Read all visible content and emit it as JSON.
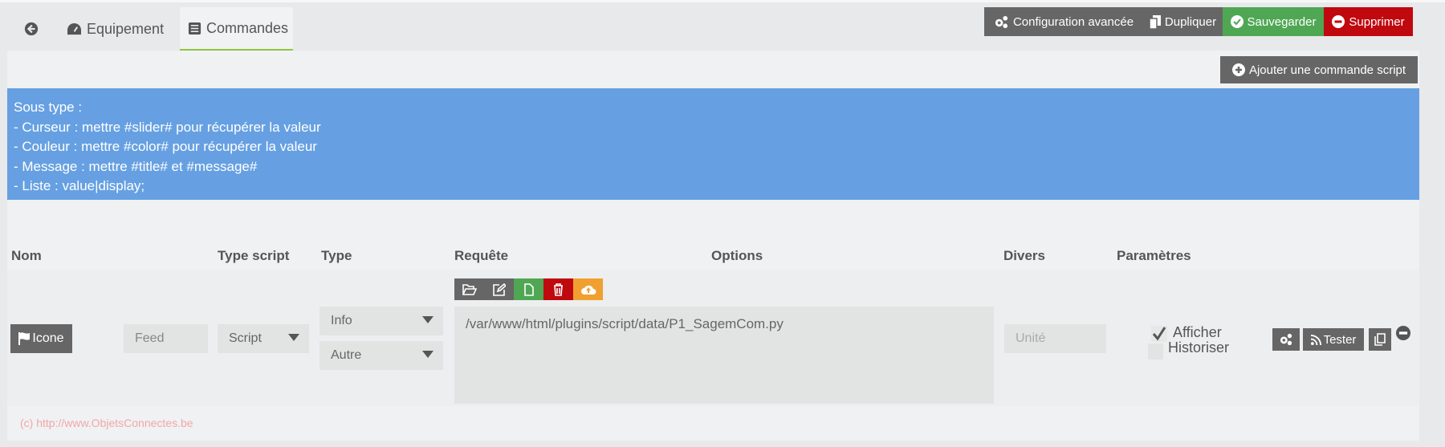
{
  "tabs": {
    "back": "arrow-left-circle-icon",
    "equipement": "Equipement",
    "commandes": "Commandes"
  },
  "toolbar": {
    "config": "Configuration avancée",
    "duplicate": "Dupliquer",
    "save": "Sauvegarder",
    "delete": "Supprimer"
  },
  "add_command": "Ajouter une commande script",
  "info": {
    "lines": [
      "Sous type :",
      "- Curseur : mettre #slider# pour récupérer la valeur",
      "- Couleur : mettre #color# pour récupérer la valeur",
      "- Message : mettre #title# et #message#",
      "- Liste : value|display;"
    ]
  },
  "table": {
    "headers": [
      "Nom",
      "Type script",
      "Type",
      "Requête",
      "Options",
      "Divers",
      "Paramètres"
    ],
    "row": {
      "icon_button": "Icone",
      "name_placeholder": "Feed",
      "type_script": "Script",
      "type": "Info",
      "subtype": "Autre",
      "request": "/var/www/html/plugins/script/data/P1_SagemCom.py",
      "unit_placeholder": "Unité",
      "afficher": "Afficher",
      "afficher_checked": true,
      "historiser": "Historiser",
      "historiser_checked": false,
      "test": "Tester"
    }
  },
  "footer": "(c) http://www.ObjetsConnectes.be",
  "colors": {
    "info": "#66a0e2",
    "save": "#4fa754",
    "delete": "#c0080f",
    "dark": "#666666",
    "warning": "#f0a030"
  }
}
